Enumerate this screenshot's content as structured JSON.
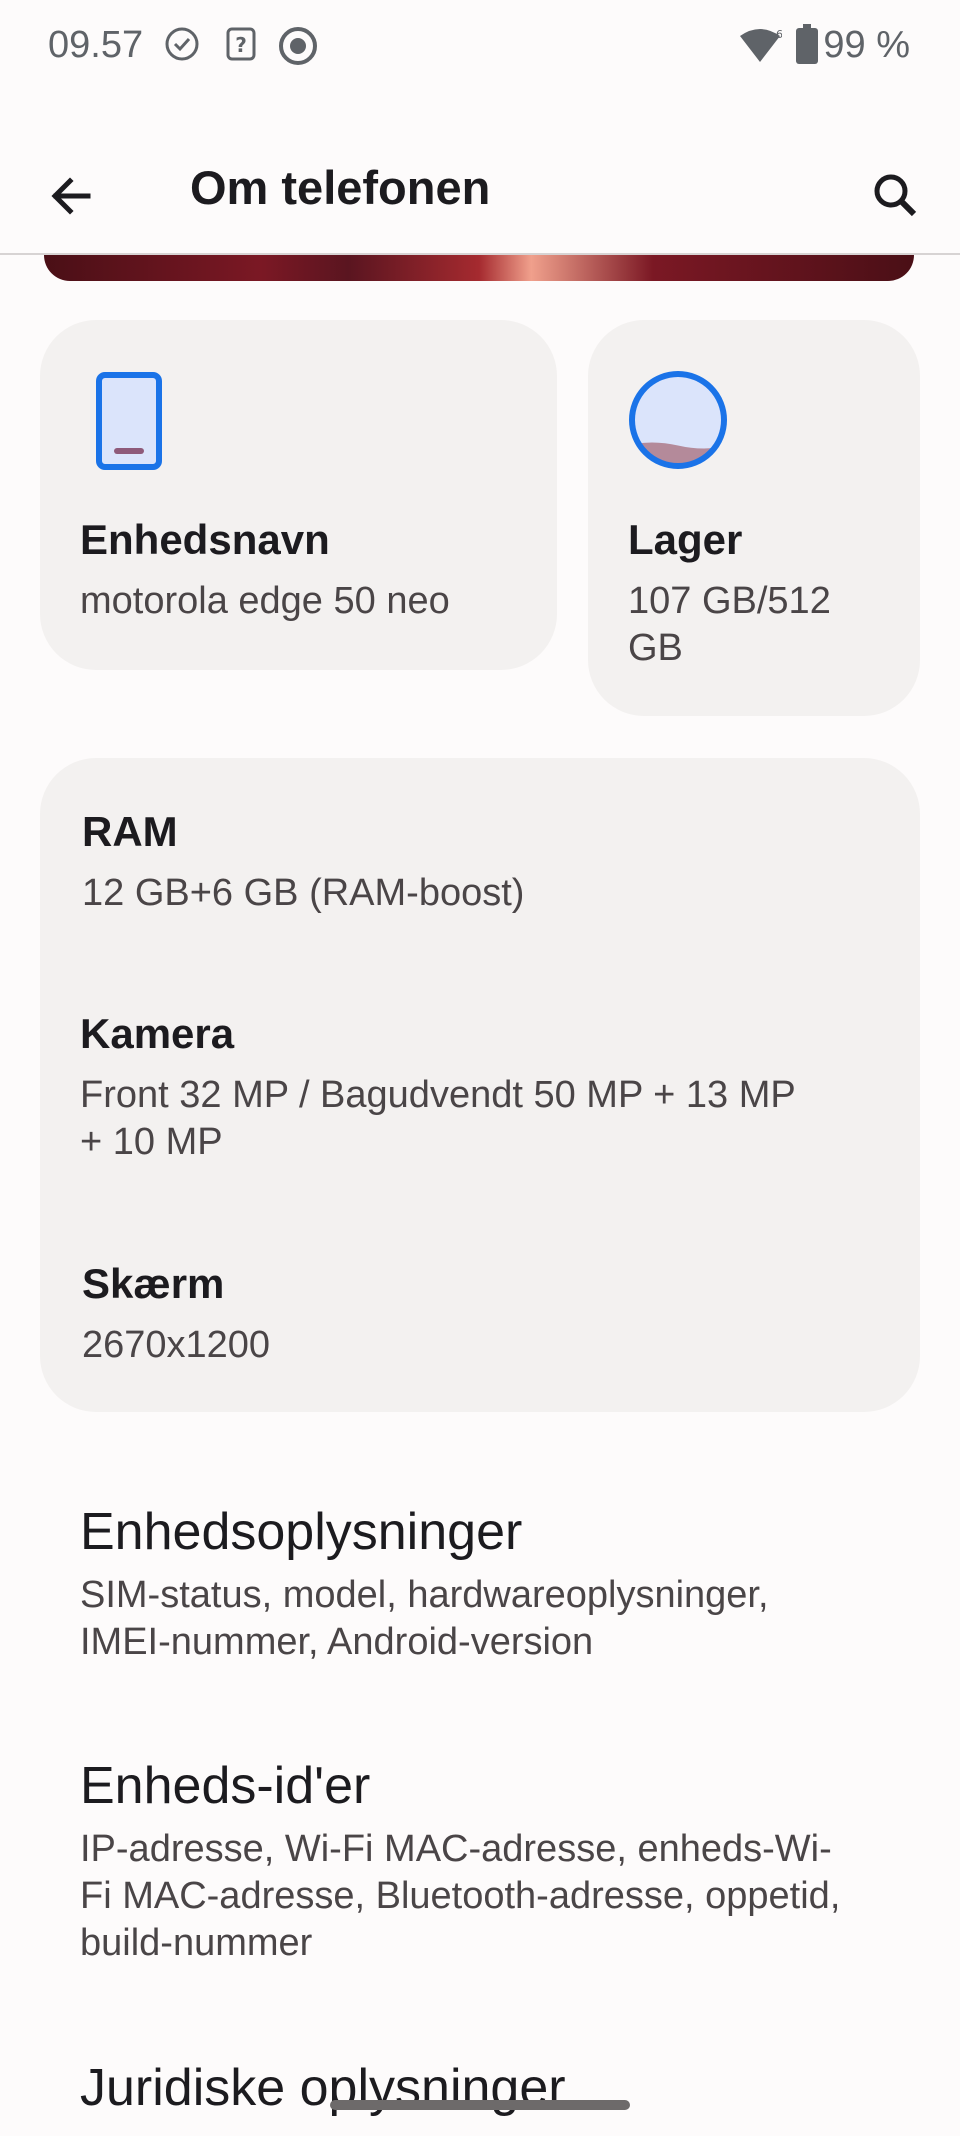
{
  "status_bar": {
    "time": "09.57",
    "battery": "99 %",
    "icons": [
      "check-circle-icon",
      "unknown-sim-icon",
      "target-icon",
      "wifi-icon",
      "battery-icon"
    ]
  },
  "app_bar": {
    "title": "Om telefonen",
    "back_icon": "arrow-back-icon",
    "search_icon": "search-icon"
  },
  "device_card": {
    "title": "Enhedsnavn",
    "value": "motorola edge 50 neo",
    "icon": "phone-icon"
  },
  "storage_card": {
    "title": "Lager",
    "value_line1": "107 GB/512",
    "value_line2": "GB",
    "icon": "storage-circle-icon",
    "used_fraction": 0.21
  },
  "specs": [
    {
      "title": "RAM",
      "lines": [
        "12 GB+6 GB (RAM-boost)"
      ]
    },
    {
      "title": "Kamera",
      "lines": [
        "Front 32 MP / Bagudvendt 50 MP + 13 MP",
        "+ 10 MP"
      ]
    },
    {
      "title": "Skærm",
      "lines": [
        "2670x1200"
      ]
    }
  ],
  "list": [
    {
      "title": "Enhedsoplysninger",
      "lines": [
        "SIM-status, model, hardwareoplysninger,",
        "IMEI-nummer, Android-version"
      ]
    },
    {
      "title": "Enheds-id'er",
      "lines": [
        "IP-adresse, Wi-Fi MAC-adresse, enheds-Wi-",
        "Fi MAC-adresse, Bluetooth-adresse, oppetid,",
        "build-nummer"
      ]
    },
    {
      "title": "Juridiske oplysninger"
    }
  ],
  "colors": {
    "accent": "#1a73e8",
    "card_bg": "#f3f1f0",
    "page_bg": "#fdfbfb"
  }
}
